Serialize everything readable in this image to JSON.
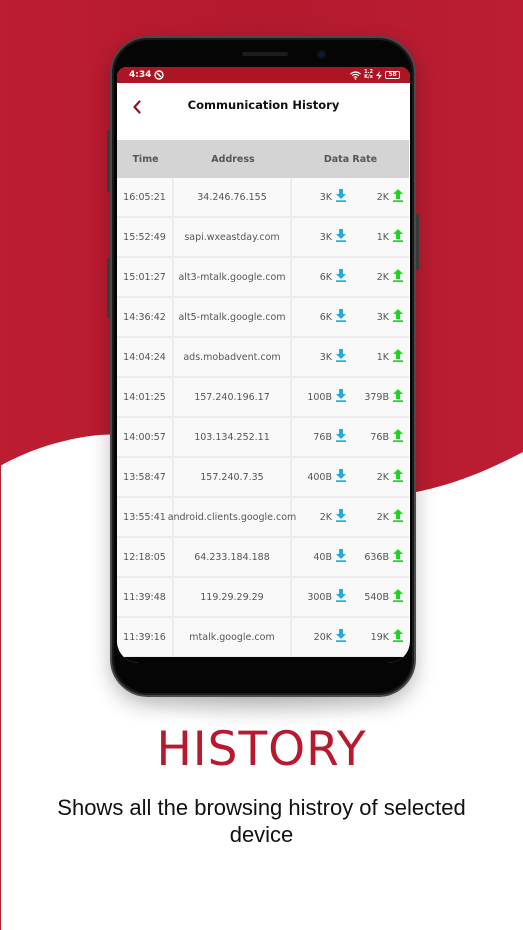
{
  "colors": {
    "brand_red": "#b8192e",
    "status_bar": "#ad1524",
    "download_arrow": "#29a8e0",
    "upload_arrow": "#1ed51e",
    "header_gray": "#d4d4d4"
  },
  "status_bar": {
    "time": "4:34",
    "left_icon": "data-saver-icon",
    "wifi_icon": "wifi-icon",
    "net_speed_top": "1.2",
    "net_speed_bottom": "K/s",
    "charging_icon": "bolt-icon",
    "battery": "58"
  },
  "app_header": {
    "back_icon": "chevron-left-icon",
    "title": "Communication History"
  },
  "table": {
    "columns": [
      "Time",
      "Address",
      "Data Rate"
    ],
    "rows": [
      {
        "time": "16:05:21",
        "address": "34.246.76.155",
        "down": "3K",
        "up": "2K"
      },
      {
        "time": "15:52:49",
        "address": "sapi.wxeastday.com",
        "down": "3K",
        "up": "1K"
      },
      {
        "time": "15:01:27",
        "address": "alt3-mtalk.google.com",
        "down": "6K",
        "up": "2K"
      },
      {
        "time": "14:36:42",
        "address": "alt5-mtalk.google.com",
        "down": "6K",
        "up": "3K"
      },
      {
        "time": "14:04:24",
        "address": "ads.mobadvent.com",
        "down": "3K",
        "up": "1K"
      },
      {
        "time": "14:01:25",
        "address": "157.240.196.17",
        "down": "100B",
        "up": "379B"
      },
      {
        "time": "14:00:57",
        "address": "103.134.252.11",
        "down": "76B",
        "up": "76B"
      },
      {
        "time": "13:58:47",
        "address": "157.240.7.35",
        "down": "400B",
        "up": "2K"
      },
      {
        "time": "13:55:41",
        "address": "android.clients.google.com",
        "down": "2K",
        "up": "2K"
      },
      {
        "time": "12:18:05",
        "address": "64.233.184.188",
        "down": "40B",
        "up": "636B"
      },
      {
        "time": "11:39:48",
        "address": "119.29.29.29",
        "down": "300B",
        "up": "540B"
      },
      {
        "time": "11:39:16",
        "address": "mtalk.google.com",
        "down": "20K",
        "up": "19K"
      }
    ],
    "download_icon": "download-arrow-icon",
    "upload_icon": "upload-arrow-icon"
  },
  "promo": {
    "title": "HISTORY",
    "subtitle": "Shows all the browsing histroy of selected device"
  }
}
